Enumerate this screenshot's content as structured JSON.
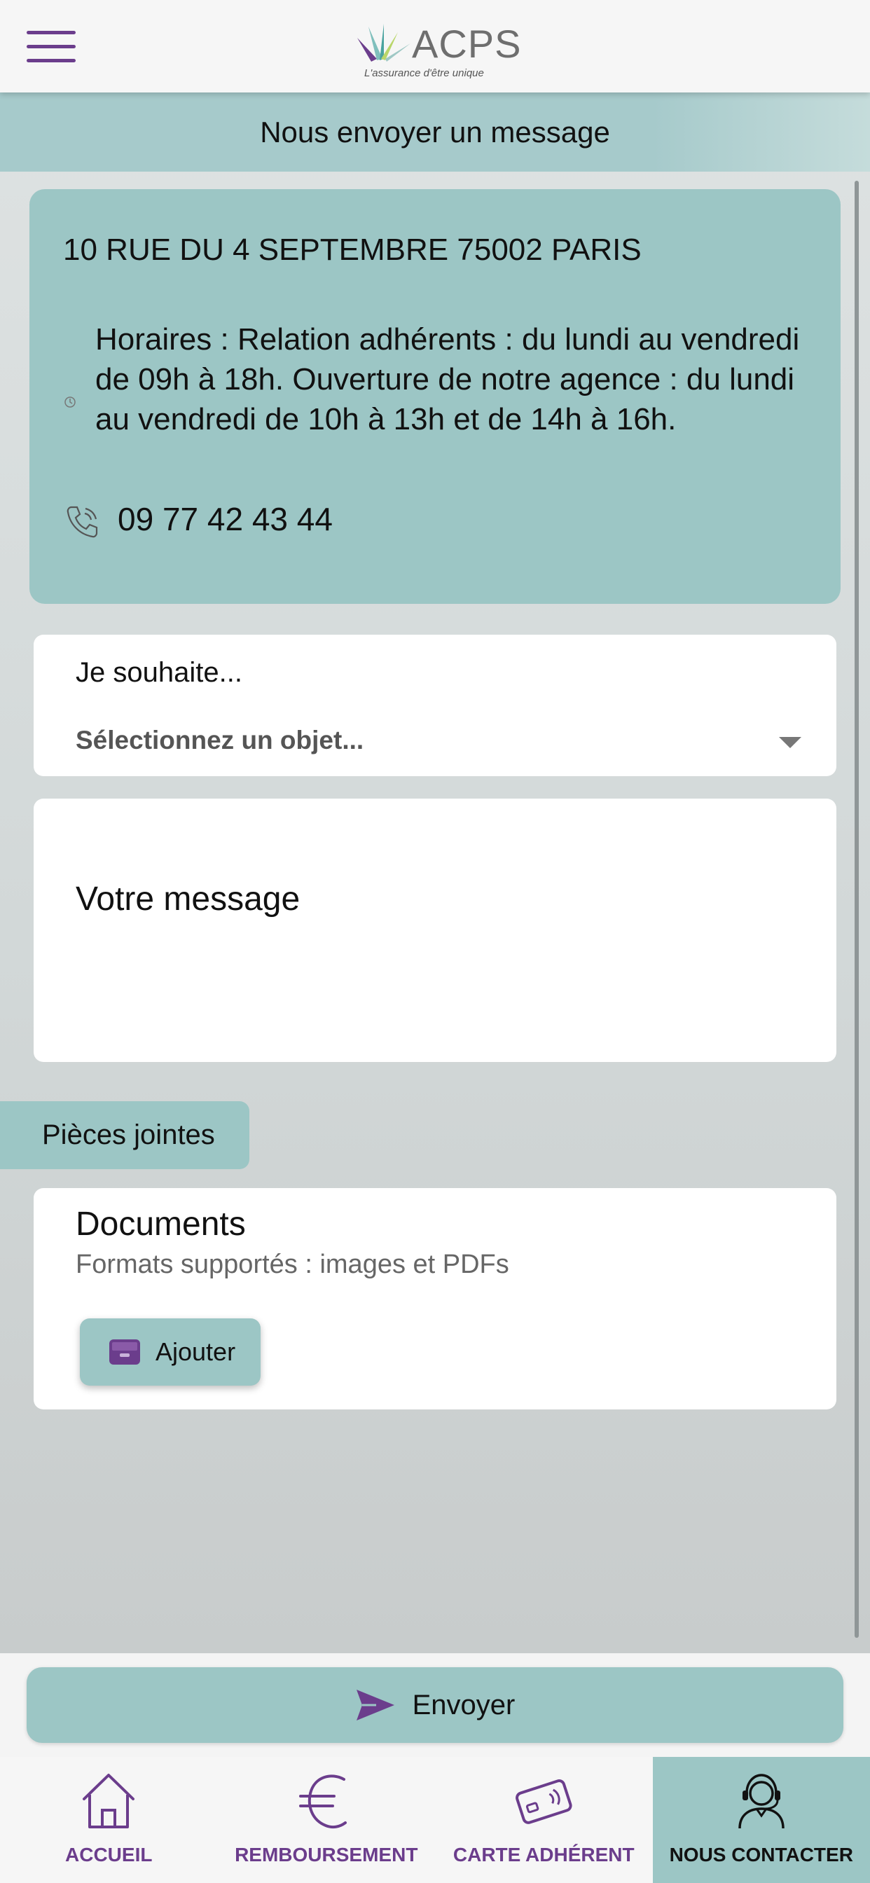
{
  "header": {
    "logo_text": "ACPS",
    "logo_tagline": "L'assurance d'être unique",
    "menu_icon": "hamburger-icon"
  },
  "page": {
    "title": "Nous envoyer un message"
  },
  "contact": {
    "address": "10 RUE DU 4 SEPTEMBRE 75002 PARIS",
    "hours": "Horaires : Relation adhérents : du lundi au vendredi de 09h à 18h. Ouverture de notre agence : du lundi au vendredi de 10h à 13h et de 14h à 16h.",
    "phone": "09 77 42 43 44",
    "hours_icon": "clock-icon",
    "phone_icon": "phone-icon"
  },
  "form": {
    "subject_label": "Je souhaite...",
    "subject_placeholder": "Sélectionnez un objet...",
    "message_placeholder": "Votre message"
  },
  "attachments": {
    "tab_label": "Pièces jointes",
    "title": "Documents",
    "subtitle": "Formats supportés : images et PDFs",
    "add_label": "Ajouter",
    "add_icon": "inbox-icon"
  },
  "actions": {
    "send_label": "Envoyer",
    "send_icon": "send-icon"
  },
  "nav": {
    "items": [
      {
        "label": "ACCUEIL",
        "icon": "home-icon",
        "active": false
      },
      {
        "label": "REMBOURSEMENT",
        "icon": "euro-icon",
        "active": false
      },
      {
        "label": "CARTE ADHÉRENT",
        "icon": "card-icon",
        "active": false
      },
      {
        "label": "NOUS CONTACTER",
        "icon": "support-agent-icon",
        "active": true
      }
    ]
  },
  "colors": {
    "accent_purple": "#6b3d8c",
    "teal": "#9cc6c5",
    "header_bg": "#f6f6f6"
  }
}
